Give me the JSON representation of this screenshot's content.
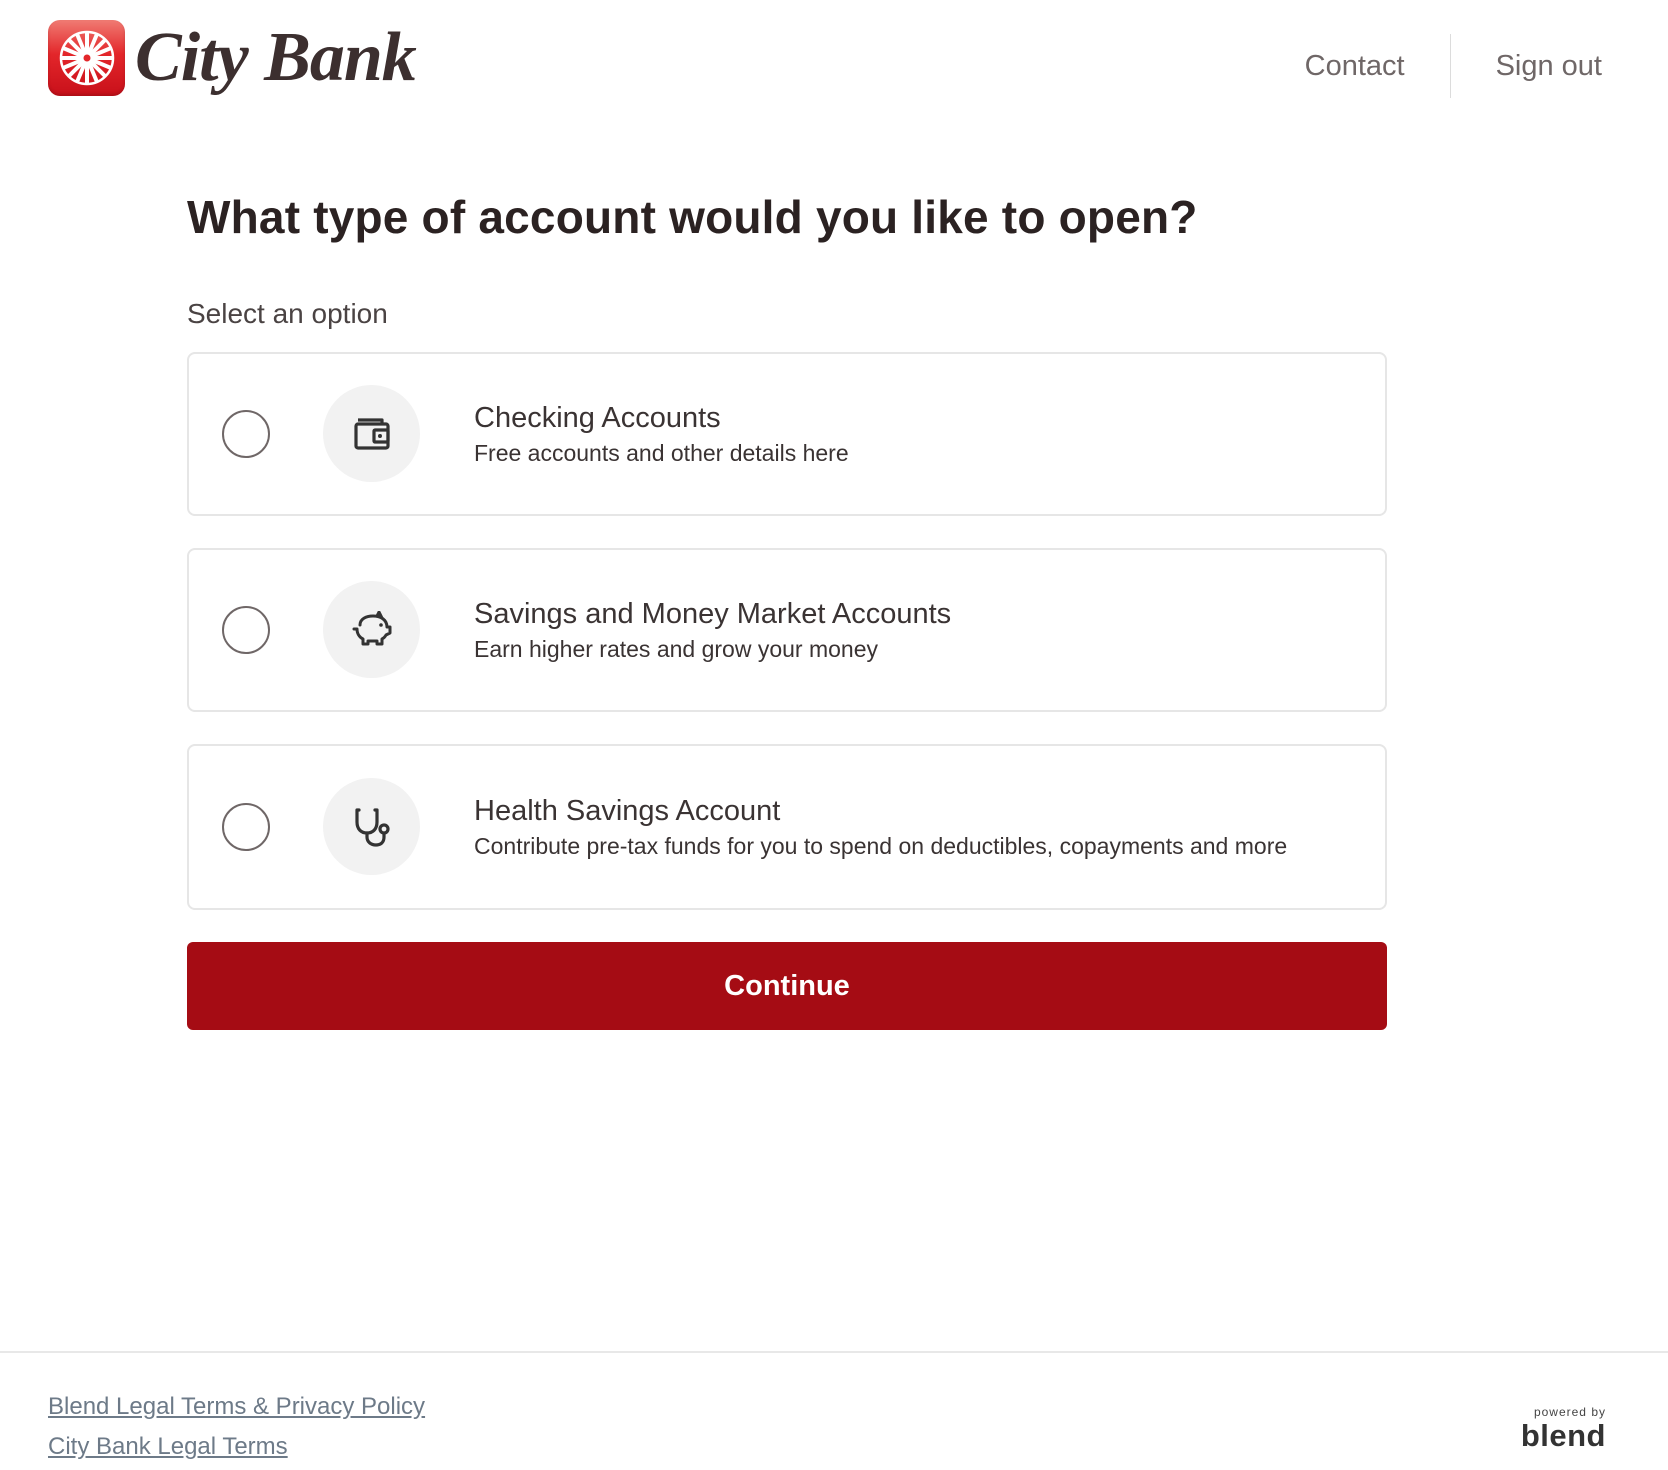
{
  "header": {
    "logo_text": "City Bank",
    "nav": {
      "contact": "Contact",
      "sign_out": "Sign out"
    }
  },
  "main": {
    "title": "What type of account would you like to open?",
    "subtitle": "Select an option",
    "options": [
      {
        "icon": "wallet-icon",
        "title": "Checking Accounts",
        "description": "Free accounts and other details here",
        "selected": false
      },
      {
        "icon": "piggy-bank-icon",
        "title": "Savings and Money Market Accounts",
        "description": "Earn higher rates and grow your money",
        "selected": false
      },
      {
        "icon": "stethoscope-icon",
        "title": "Health Savings Account",
        "description": "Contribute pre-tax funds for you to spend on deductibles, copayments and more",
        "selected": false
      }
    ],
    "continue_label": "Continue"
  },
  "footer": {
    "links": [
      "Blend Legal Terms & Privacy Policy",
      "City Bank Legal Terms"
    ],
    "powered_by": "powered by",
    "brand": "blend"
  },
  "colors": {
    "primary_button": "#a50c14",
    "logo_red": "#e3262a",
    "link": "#6d7a88",
    "text": "#2b2222"
  }
}
